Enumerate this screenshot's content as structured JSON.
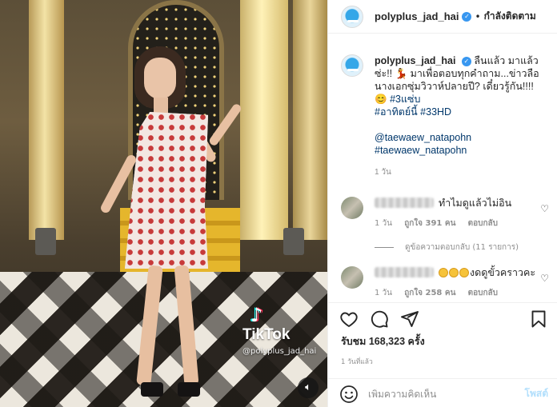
{
  "media": {
    "watermark": {
      "brand": "TikTok",
      "handle": "@polyplus_jad_hai"
    },
    "mute_icon": "speaker-icon"
  },
  "header": {
    "username": "polyplus_jad_hai",
    "verified": true,
    "separator": "•",
    "follow_label": "กำลังติดตาม"
  },
  "caption": {
    "username": "polyplus_jad_hai",
    "text": "ลืนแล้ว มาแล้วซ่ะ!! 💃 มาเพื่อตอบทุกคำถาม...ข่าวลือนางเอกซุ่มวิวาห์ปลายปี? เดี๋ยวรู้กัน!!!! 😊",
    "hashtags_inline": "#3แซ่บ",
    "hashtag_line2": "#อาทิตย์นี้ #33HD",
    "mention": "@taewaew_natapohn",
    "mention_tag": "#taewaew_natapohn",
    "time": "1 วัน"
  },
  "comments": [
    {
      "text": "ทำไมดูแล้วไม่อิน",
      "emoji_count": 0,
      "time": "1 วัน",
      "likes": "ถูกใจ 391 คน",
      "reply": "ตอบกลับ",
      "replies_label": "ดูข้อความตอบกลับ (11 รายการ)"
    },
    {
      "text": "งดดูขั้วคราวคะ",
      "emoji_count": 3,
      "time": "1 วัน",
      "likes": "ถูกใจ 258 คน",
      "reply": "ตอบกลับ"
    }
  ],
  "actions": {
    "icons": [
      "heart-icon",
      "comment-icon",
      "share-icon",
      "bookmark-icon"
    ],
    "views": "รับชม 168,323 ครั้ง",
    "time_ago": "1 วันที่แล้ว"
  },
  "comment_box": {
    "placeholder": "เพิ่มความคิดเห็น",
    "post_label": "โพสต์"
  },
  "colors": {
    "verified": "#3897f0",
    "link": "#00376b",
    "muted": "#8e8e8e",
    "post_disabled": "#b2dffc"
  }
}
